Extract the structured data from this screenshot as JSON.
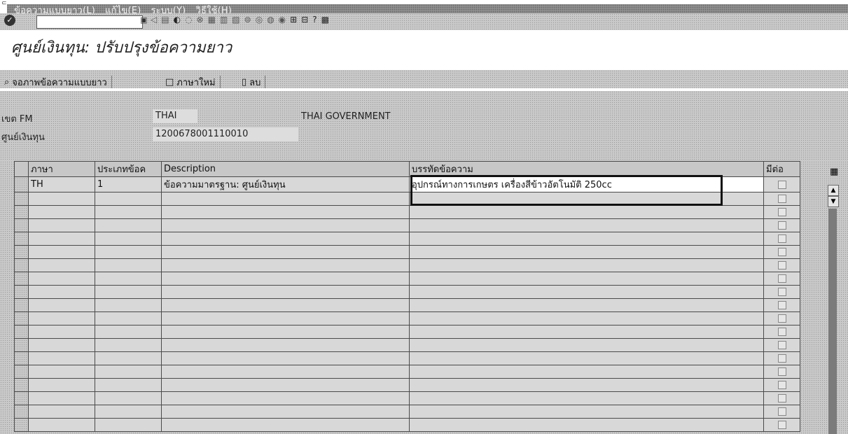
{
  "menu": {
    "items": [
      "ข้อความแบบยาว(L)",
      "แก้ไข(E)",
      "ระบบ(Y)",
      "วิธีใช้(H)"
    ]
  },
  "toolbar": {
    "command_value": ""
  },
  "page": {
    "title": "ศูนย์เงินทุน: ปรับปรุงข้อความยาว"
  },
  "app_toolbar": {
    "display_longtext_label": "จอภาพข้อความแบบยาว",
    "new_language_label": "ภาษาใหม่",
    "delete_label": "ลบ"
  },
  "header": {
    "fm_area_label": "เขต FM",
    "fm_area_value": "THAI",
    "fm_area_text": "THAI GOVERNMENT",
    "fund_center_label": "ศูนย์เงินทุน",
    "fund_center_value": "1200678001110010"
  },
  "table": {
    "columns": [
      "ภาษา",
      "ประเภทข้อค",
      "Description",
      "บรรทัดข้อความ",
      "มีต่อ"
    ],
    "rows": [
      {
        "lang": "TH",
        "type": "1",
        "description": "ข้อความมาตรฐาน: ศูนย์เงินทุน",
        "text_line": "อุปกรณ์ทางการเกษตร เครื่องสีข้าวอัตโนมัติ 250cc",
        "continued": false
      }
    ],
    "empty_rows": 18
  },
  "colors": {
    "menu_bg": "#8f8f8f",
    "screen_bg": "#c9c9c9",
    "highlight_border": "#111111"
  }
}
